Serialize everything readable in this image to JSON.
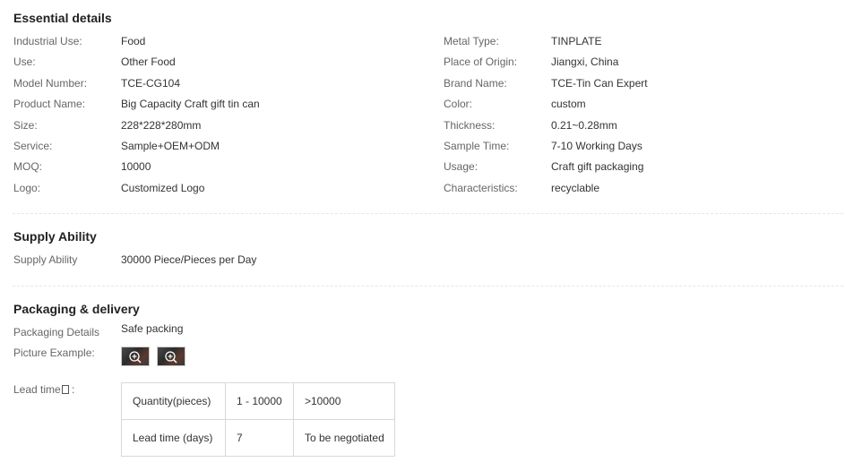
{
  "essential": {
    "title": "Essential details",
    "left": [
      {
        "label": "Industrial Use:",
        "value": "Food"
      },
      {
        "label": "Use:",
        "value": "Other Food"
      },
      {
        "label": "Model Number:",
        "value": "TCE-CG104"
      },
      {
        "label": "Product Name:",
        "value": "Big Capacity Craft gift tin can"
      },
      {
        "label": "Size:",
        "value": "228*228*280mm"
      },
      {
        "label": "Service:",
        "value": "Sample+OEM+ODM"
      },
      {
        "label": "MOQ:",
        "value": "10000"
      },
      {
        "label": "Logo:",
        "value": "Customized Logo"
      }
    ],
    "right": [
      {
        "label": "Metal Type:",
        "value": "TINPLATE"
      },
      {
        "label": "Place of Origin:",
        "value": "Jiangxi, China"
      },
      {
        "label": "Brand Name:",
        "value": "TCE-Tin Can Expert"
      },
      {
        "label": "Color:",
        "value": "custom"
      },
      {
        "label": "Thickness:",
        "value": "0.21~0.28mm"
      },
      {
        "label": "Sample Time:",
        "value": "7-10 Working Days"
      },
      {
        "label": "Usage:",
        "value": "Craft gift packaging"
      },
      {
        "label": "Characteristics:",
        "value": "recyclable"
      }
    ]
  },
  "supply": {
    "title": "Supply Ability",
    "label": "Supply Ability",
    "value": "30000 Piece/Pieces per Day"
  },
  "packaging": {
    "title": "Packaging & delivery",
    "details_label": "Packaging Details",
    "details_value": "Safe packing",
    "picture_label": "Picture Example:",
    "lead_label": "Lead time",
    "lead_table": {
      "row1": [
        "Quantity(pieces)",
        "1 - 10000",
        ">10000"
      ],
      "row2": [
        "Lead time (days)",
        "7",
        "To be negotiated"
      ]
    }
  }
}
